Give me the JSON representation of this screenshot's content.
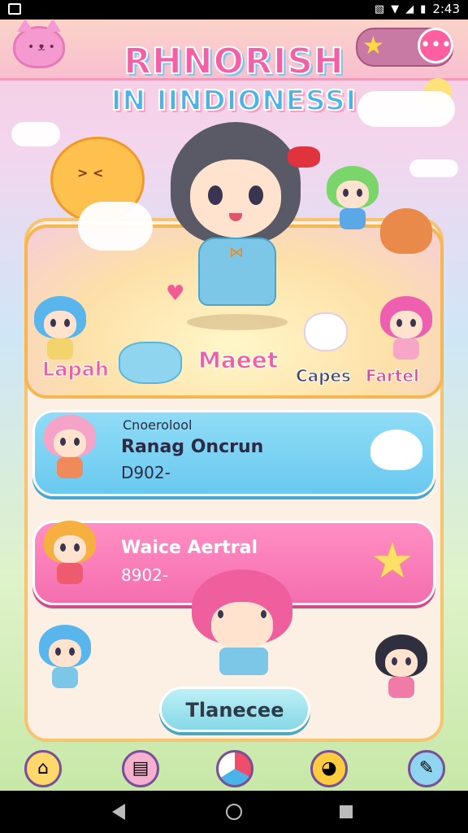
{
  "status_bar": {
    "time": "2:43",
    "icons": [
      "image-icon",
      "vibrate-icon",
      "wifi-icon",
      "signal-icon",
      "battery-icon"
    ]
  },
  "header": {
    "title_line1": "RHNORISH",
    "title_line2": "IN IINDIONESSI"
  },
  "feature_panel": {
    "labels": [
      "Lapah",
      "Maeet",
      "Capes",
      "Fartel"
    ]
  },
  "rows": [
    {
      "subtitle": "Cnoerolool",
      "title": "Ranag Oncrun",
      "value": "D902-"
    },
    {
      "title": "Waice Aertral",
      "value": "8902-"
    }
  ],
  "transfer_button": {
    "label": "Tlanecee"
  },
  "bottom_nav": {
    "items": [
      "home-icon",
      "card-icon",
      "ball-icon",
      "chick-icon",
      "edit-icon"
    ]
  },
  "colors": {
    "accent_pink": "#f55fa6",
    "accent_blue": "#4ab4e8",
    "panel_border": "#f7b750",
    "row_blue": "#6ac9f0",
    "row_pink": "#f46eaf"
  }
}
